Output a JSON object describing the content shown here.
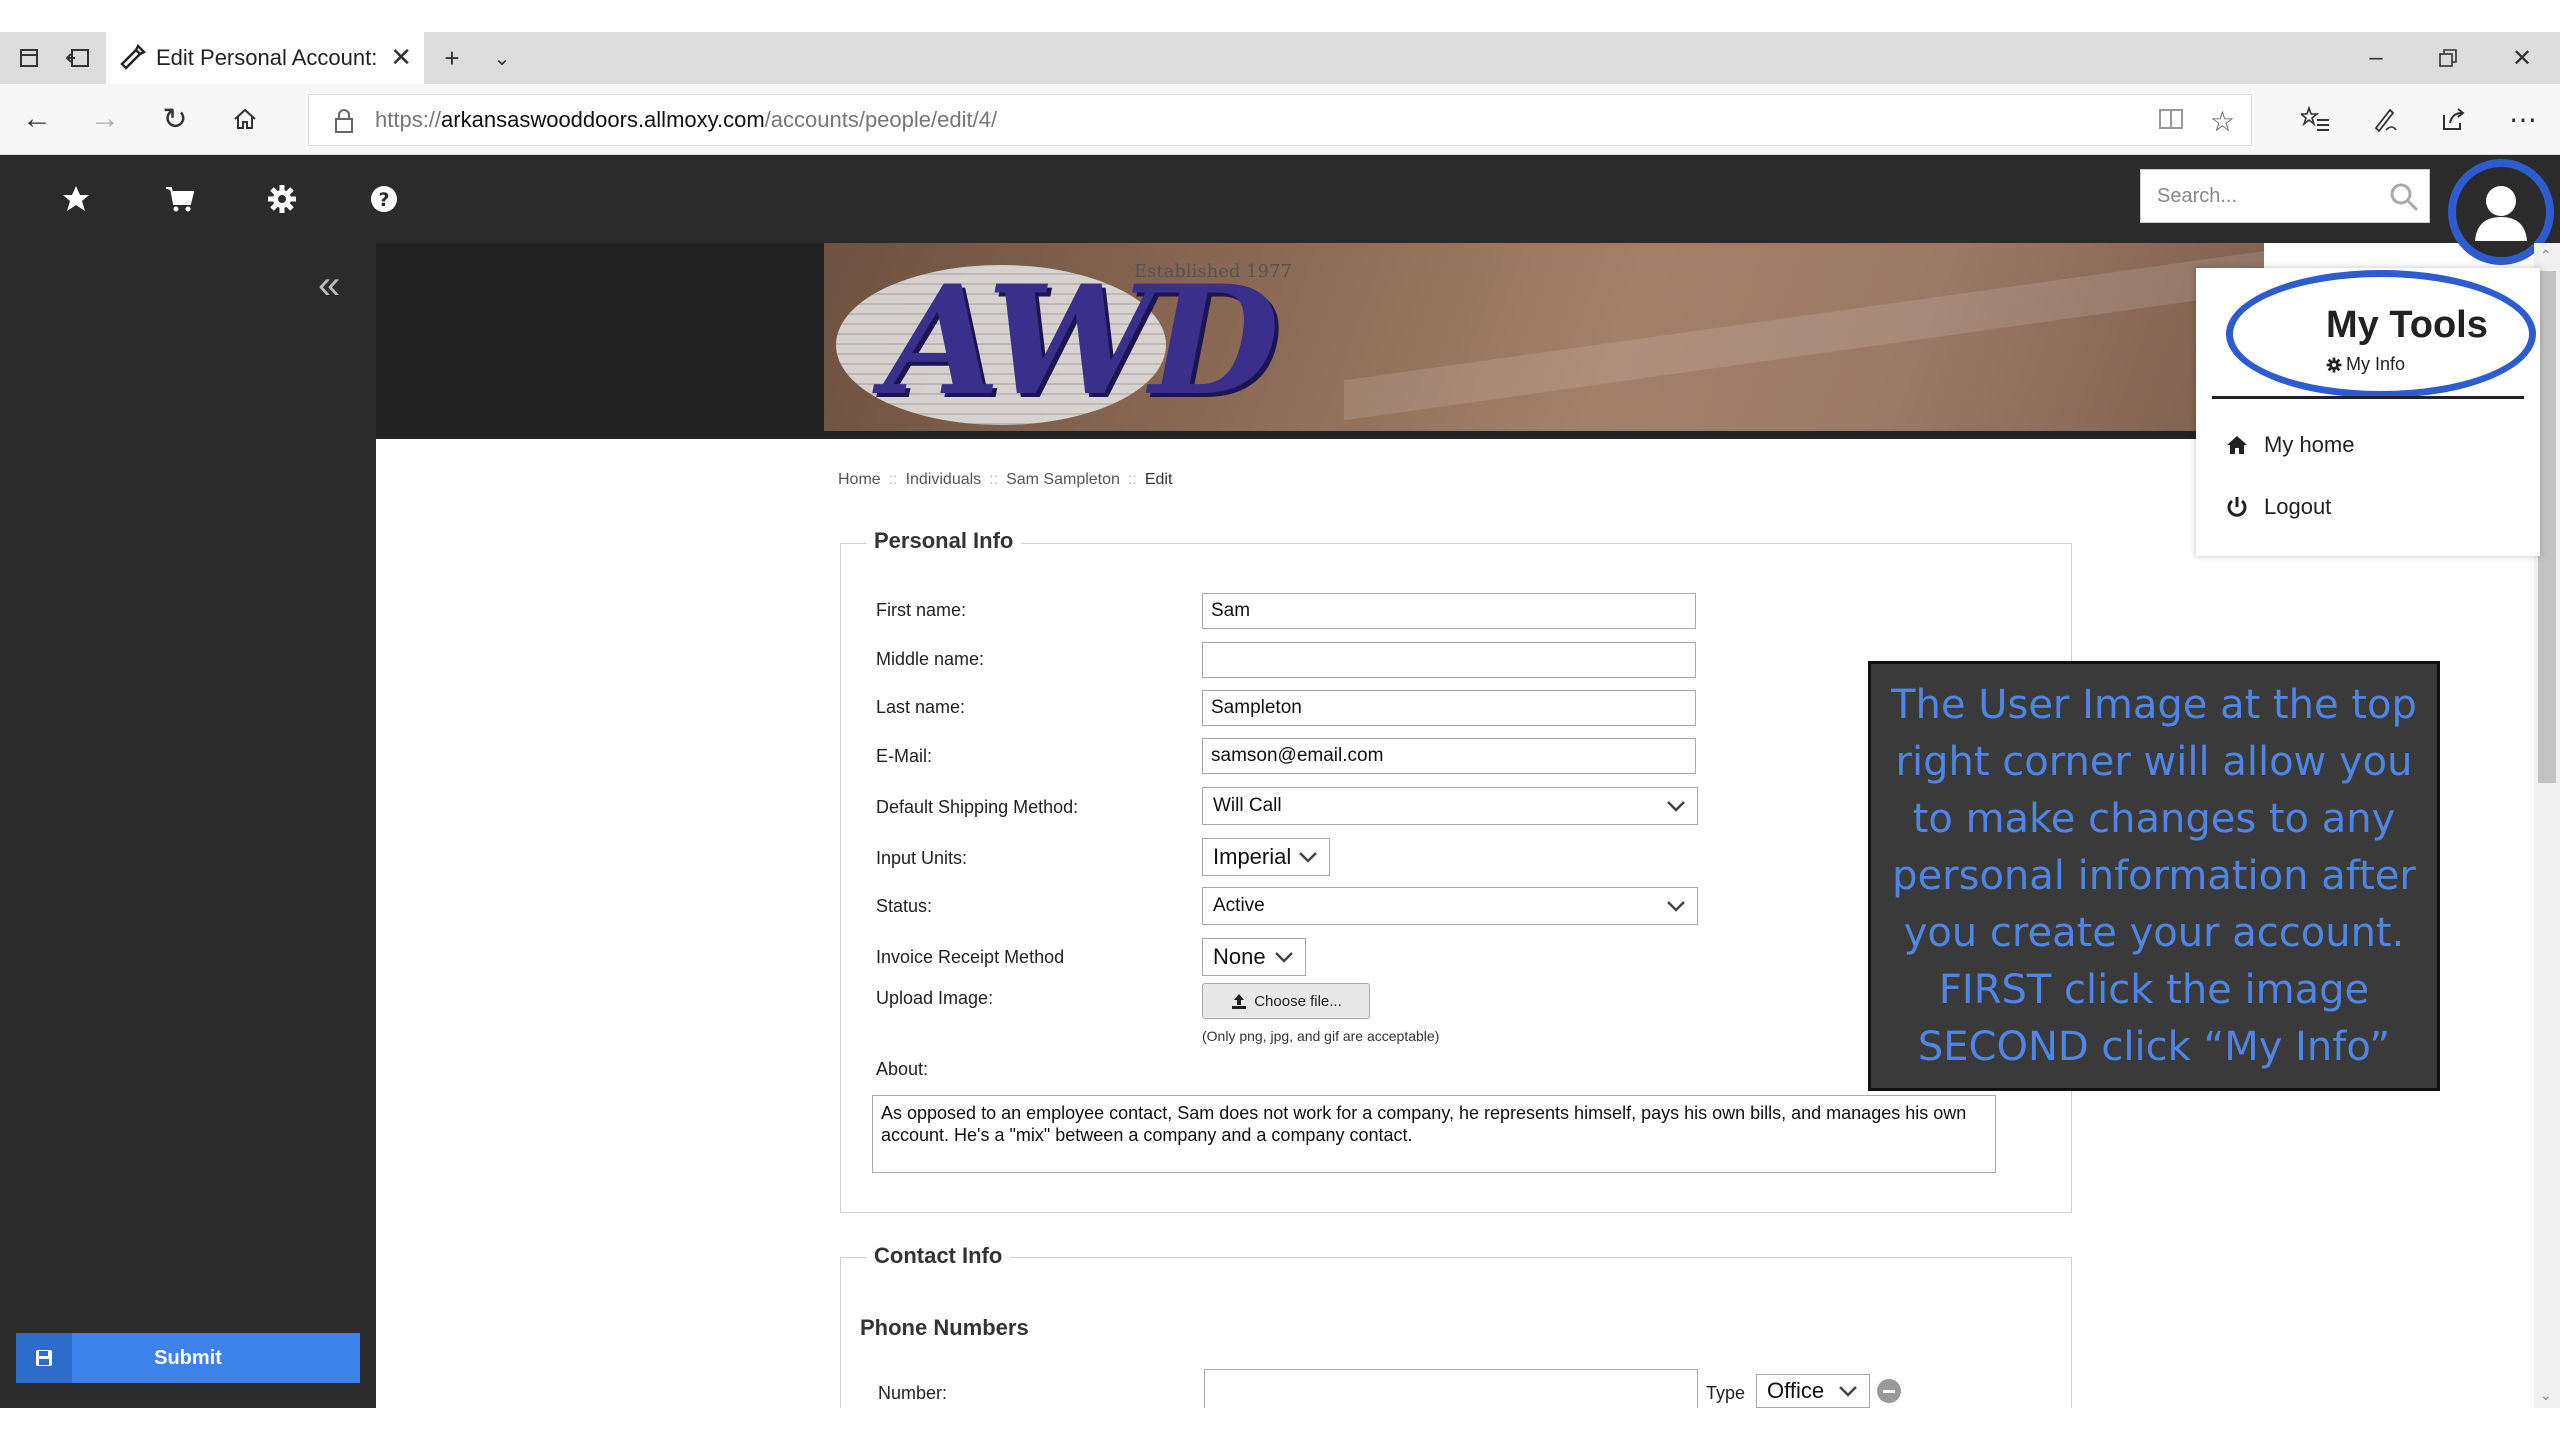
{
  "browser": {
    "tab_title": "Edit Personal Account: Sam Sampleton",
    "url_scheme": "https://",
    "url_host": "arkansaswooddoors.allmoxy.com",
    "url_path": "/accounts/people/edit/4/"
  },
  "app": {
    "search_placeholder": "Search...",
    "submit_label": "Submit"
  },
  "banner": {
    "logo_text": "AWD",
    "established": "Established 1977"
  },
  "breadcrumb": {
    "items": [
      "Home",
      "Individuals",
      "Sam Sampleton",
      "Edit"
    ],
    "separator": "::"
  },
  "personal_info": {
    "legend": "Personal Info",
    "first_name_label": "First name:",
    "first_name": "Sam",
    "middle_name_label": "Middle name:",
    "middle_name": "",
    "last_name_label": "Last name:",
    "last_name": "Sampleton",
    "email_label": "E-Mail:",
    "email": "samson@email.com",
    "shipping_label": "Default Shipping Method:",
    "shipping": "Will Call",
    "units_label": "Input Units:",
    "units": "Imperial",
    "status_label": "Status:",
    "status": "Active",
    "invoice_label": "Invoice Receipt Method",
    "invoice": "None",
    "upload_label": "Upload Image:",
    "choose_file": "Choose file...",
    "upload_note": "(Only png, jpg, and gif are acceptable)",
    "about_label": "About:",
    "about": "As opposed to an employee contact, Sam does not work for a company, he represents himself, pays his own bills, and manages his own account. He's a \"mix\" between a company and a company contact."
  },
  "contact_info": {
    "legend": "Contact Info",
    "phone_heading": "Phone Numbers",
    "number_label": "Number:",
    "number": "",
    "type_label": "Type",
    "type": "Office"
  },
  "dropdown": {
    "title": "My Tools",
    "my_info": "My Info",
    "my_home": "My home",
    "logout": "Logout"
  },
  "callout": {
    "text": "The User Image at the top right corner will allow you to make changes to any personal information after you create your account. FIRST click the image SECOND click “My Info”"
  },
  "colors": {
    "accent": "#3d82e8",
    "annotation_ring": "#2f5bd0",
    "annotation_text": "#4f86e6",
    "app_bar": "#2b2b2b"
  }
}
